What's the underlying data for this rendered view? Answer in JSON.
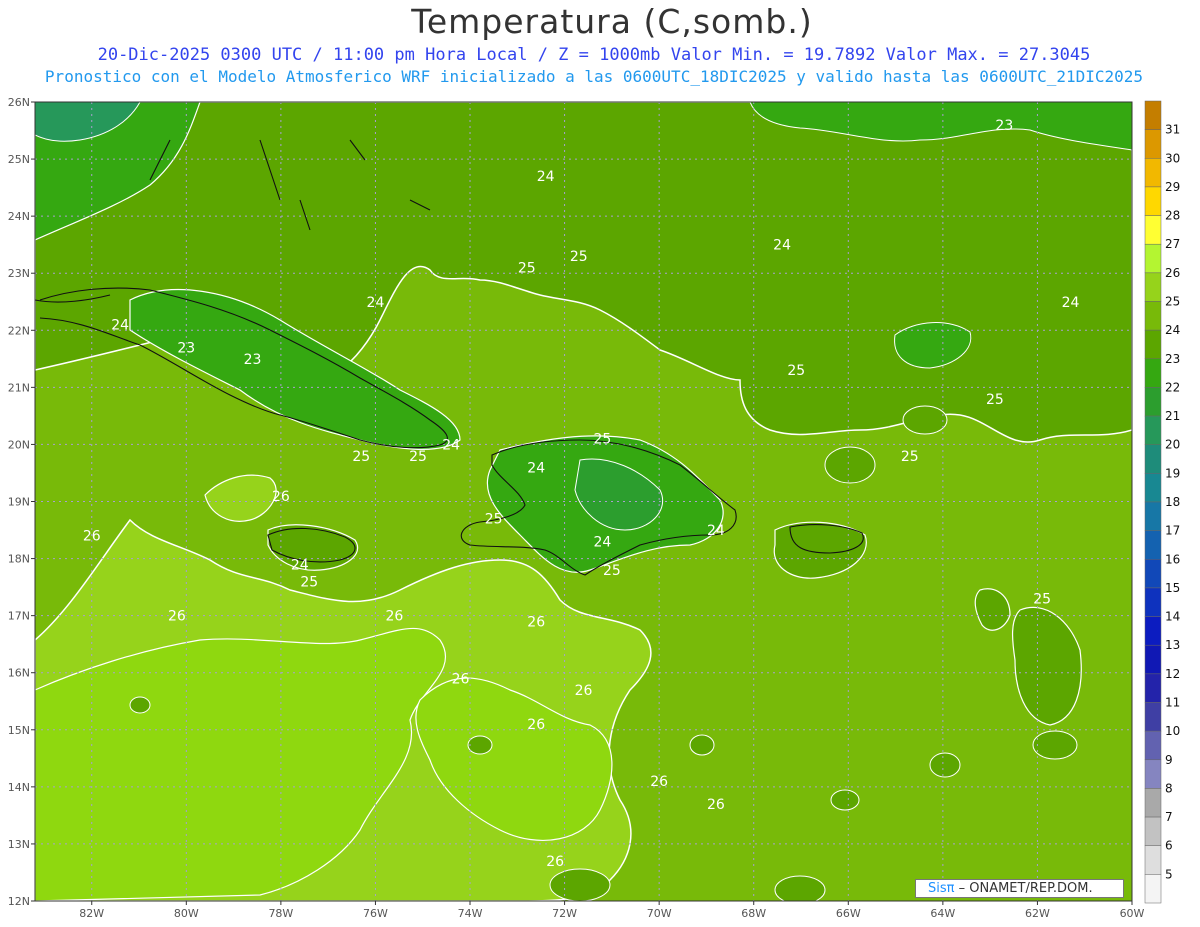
{
  "header": {
    "title": "Temperatura (C,somb.)",
    "subtitle1": "20-Dic-2025 0300 UTC / 11:00 pm Hora Local / Z = 1000mb  Valor Min. = 19.7892  Valor Max. = 27.3045",
    "subtitle2": "Pronostico con el Modelo Atmosferico WRF inicializado a las 0600UTC_18DIC2025 y valido hasta las  0600UTC_21DIC2025"
  },
  "map": {
    "lon_range": [
      -83.2,
      -60
    ],
    "lat_range": [
      12,
      26
    ],
    "lon_ticks": [
      "82W",
      "80W",
      "78W",
      "76W",
      "74W",
      "72W",
      "70W",
      "68W",
      "66W",
      "64W",
      "62W",
      "60W"
    ],
    "lat_ticks": [
      "12N",
      "13N",
      "14N",
      "15N",
      "16N",
      "17N",
      "18N",
      "19N",
      "20N",
      "21N",
      "22N",
      "23N",
      "24N",
      "25N",
      "26N"
    ],
    "grid": true,
    "contour_labels": [
      {
        "text": "24",
        "lon": -81.4,
        "lat": 22.1
      },
      {
        "text": "23",
        "lon": -80.0,
        "lat": 21.7
      },
      {
        "text": "23",
        "lon": -78.6,
        "lat": 21.5
      },
      {
        "text": "24",
        "lon": -76.0,
        "lat": 22.5
      },
      {
        "text": "25",
        "lon": -72.8,
        "lat": 23.1
      },
      {
        "text": "25",
        "lon": -71.7,
        "lat": 23.3
      },
      {
        "text": "24",
        "lon": -72.4,
        "lat": 24.7
      },
      {
        "text": "24",
        "lon": -67.4,
        "lat": 23.5
      },
      {
        "text": "23",
        "lon": -62.7,
        "lat": 25.6
      },
      {
        "text": "24",
        "lon": -61.3,
        "lat": 22.5
      },
      {
        "text": "25",
        "lon": -67.1,
        "lat": 21.3
      },
      {
        "text": "25",
        "lon": -62.9,
        "lat": 20.8
      },
      {
        "text": "25",
        "lon": -64.7,
        "lat": 19.8
      },
      {
        "text": "25",
        "lon": -71.2,
        "lat": 20.1
      },
      {
        "text": "24",
        "lon": -72.6,
        "lat": 19.6
      },
      {
        "text": "25",
        "lon": -73.5,
        "lat": 18.7
      },
      {
        "text": "24",
        "lon": -71.2,
        "lat": 18.3
      },
      {
        "text": "25",
        "lon": -71.0,
        "lat": 17.8
      },
      {
        "text": "24",
        "lon": -68.8,
        "lat": 18.5
      },
      {
        "text": "24",
        "lon": -74.4,
        "lat": 20.0
      },
      {
        "text": "25",
        "lon": -75.1,
        "lat": 19.8
      },
      {
        "text": "25",
        "lon": -76.3,
        "lat": 19.8
      },
      {
        "text": "26",
        "lon": -78.0,
        "lat": 19.1
      },
      {
        "text": "24",
        "lon": -77.6,
        "lat": 17.9
      },
      {
        "text": "25",
        "lon": -77.4,
        "lat": 17.6
      },
      {
        "text": "26",
        "lon": -82.0,
        "lat": 18.4
      },
      {
        "text": "26",
        "lon": -80.2,
        "lat": 17.0
      },
      {
        "text": "26",
        "lon": -75.6,
        "lat": 17.0
      },
      {
        "text": "26",
        "lon": -72.6,
        "lat": 16.9
      },
      {
        "text": "26",
        "lon": -74.2,
        "lat": 15.9
      },
      {
        "text": "26",
        "lon": -72.6,
        "lat": 15.1
      },
      {
        "text": "26",
        "lon": -71.6,
        "lat": 15.7
      },
      {
        "text": "26",
        "lon": -70.0,
        "lat": 14.1
      },
      {
        "text": "26",
        "lon": -68.8,
        "lat": 13.7
      },
      {
        "text": "26",
        "lon": -72.2,
        "lat": 12.7
      },
      {
        "text": "25",
        "lon": -61.9,
        "lat": 17.3
      }
    ]
  },
  "colorbar": {
    "levels": [
      31,
      30,
      29,
      28,
      27,
      26,
      25,
      24,
      23,
      22,
      21,
      20,
      19,
      18,
      17,
      16,
      15,
      14,
      13,
      12,
      11,
      10,
      9,
      8,
      7,
      6,
      5
    ],
    "colors": [
      "#c47e00",
      "#dc9800",
      "#f2b800",
      "#ffd800",
      "#ffff33",
      "#b4f531",
      "#96d31b",
      "#78ba09",
      "#5ca600",
      "#35a811",
      "#2c9e2e",
      "#26985a",
      "#1e8c7a",
      "#188892",
      "#1777a6",
      "#1462b0",
      "#1148b8",
      "#0e32be",
      "#0c1cc0",
      "#1018b4",
      "#2323aa",
      "#3f3fa4",
      "#6262b0",
      "#8585c0",
      "#a9a9a9",
      "#c2c2c2",
      "#dedede",
      "#f4f4f4"
    ]
  },
  "credit": {
    "brand": "Sisπ",
    "org": "ONAMET/REP.DOM."
  }
}
